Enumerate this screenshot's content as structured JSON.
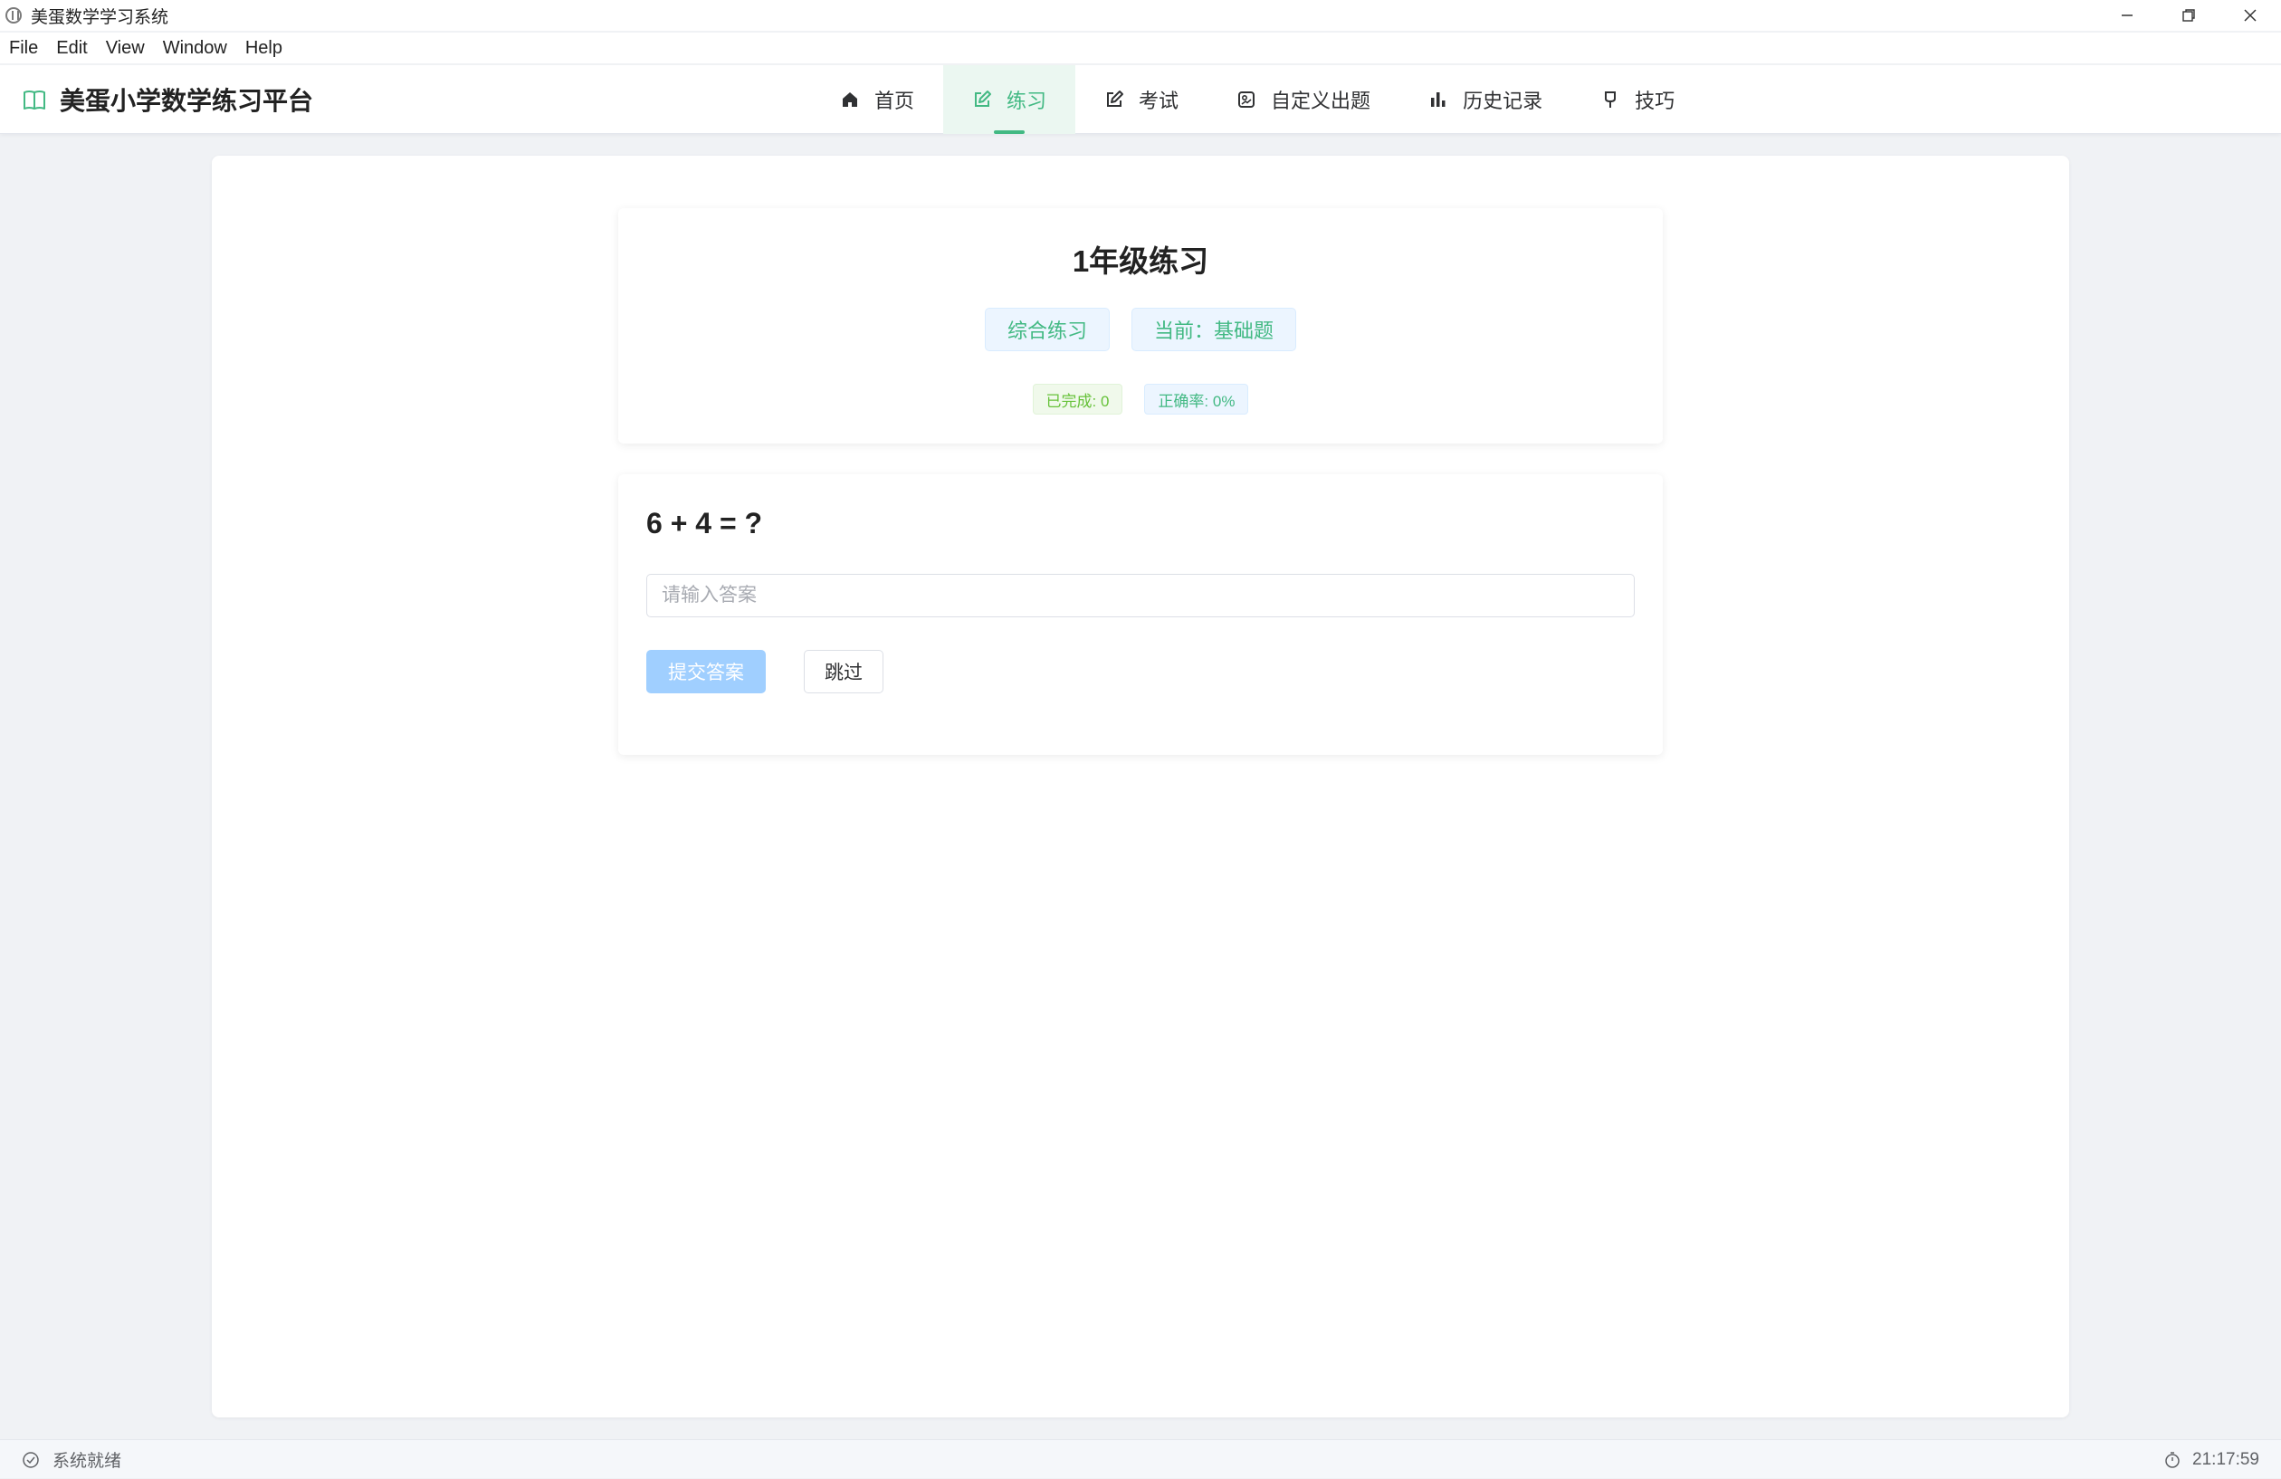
{
  "window": {
    "title": "美蛋数学学习系统"
  },
  "menu": {
    "items": [
      "File",
      "Edit",
      "View",
      "Window",
      "Help"
    ]
  },
  "header": {
    "brand_title": "美蛋小学数学练习平台",
    "nav": [
      {
        "label": "首页",
        "icon": "home-icon",
        "active": false
      },
      {
        "label": "练习",
        "icon": "edit-icon",
        "active": true
      },
      {
        "label": "考试",
        "icon": "edit-square-icon",
        "active": false
      },
      {
        "label": "自定义出题",
        "icon": "document-icon",
        "active": false
      },
      {
        "label": "历史记录",
        "icon": "bar-chart-icon",
        "active": false
      },
      {
        "label": "技巧",
        "icon": "pin-icon",
        "active": false
      }
    ]
  },
  "practice": {
    "title": "1年级练习",
    "mode_tag": "综合练习",
    "level_tag": "当前：基础题",
    "completed": "已完成: 0",
    "accuracy": "正确率: 0%"
  },
  "question": {
    "text": "6 + 4 = ?",
    "answer_value": "",
    "answer_placeholder": "请输入答案",
    "submit_label": "提交答案",
    "skip_label": "跳过"
  },
  "status": {
    "text": "系统就绪",
    "time": "21:17:59"
  },
  "colors": {
    "accent": "#42b983",
    "accent_bg": "#ebf7f1",
    "success": "#67c23a",
    "disabled_primary": "#a0cfff",
    "page_bg": "#f0f2f5"
  }
}
